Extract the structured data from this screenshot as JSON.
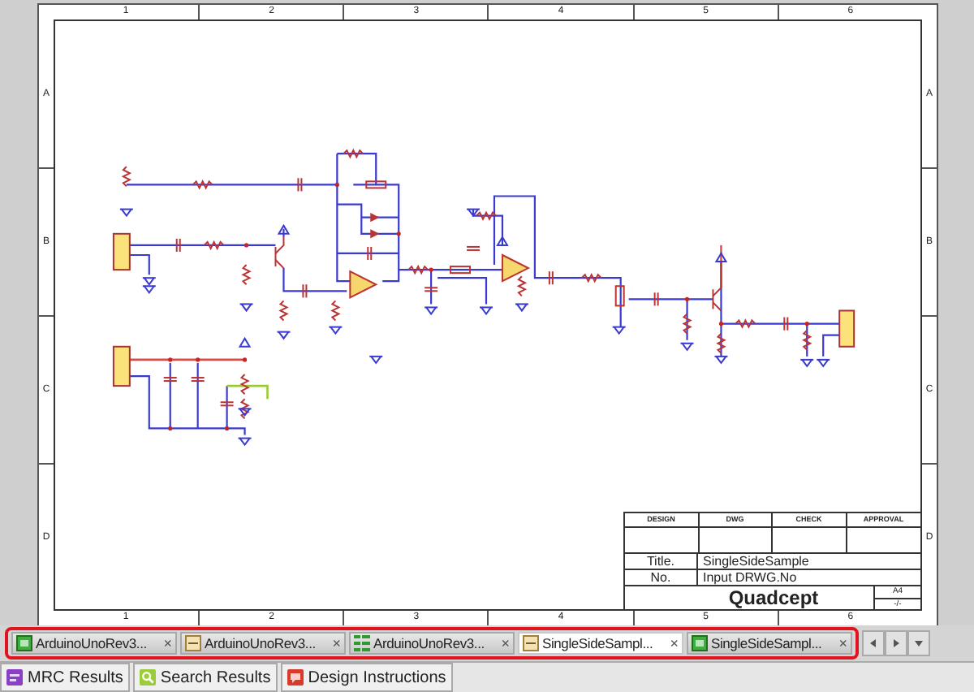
{
  "sheet": {
    "top_zones": [
      "1",
      "2",
      "3",
      "4",
      "5",
      "6"
    ],
    "side_zones_left": [
      "A",
      "B",
      "C",
      "D"
    ],
    "side_zones_right": [
      "A",
      "B",
      "C",
      "D"
    ],
    "bottom_zones": [
      "1",
      "2",
      "3",
      "4",
      "5",
      "6"
    ],
    "title_block": {
      "headers": [
        "DESIGN",
        "DWG",
        "CHECK",
        "APPROVAL"
      ],
      "title_label": "Title.",
      "title_value": "SingleSideSample",
      "number_label": "No.",
      "number_value": "Input DRWG.No",
      "company": "Quadcept",
      "size": "A4",
      "sheet_number": "-/-"
    }
  },
  "document_tabs": [
    {
      "label": "ArduinoUnoRev3...",
      "kind": "green",
      "close": "×",
      "selected": false
    },
    {
      "label": "ArduinoUnoRev3...",
      "kind": "tan",
      "close": "×",
      "selected": false
    },
    {
      "label": "ArduinoUnoRev3...",
      "kind": "grid",
      "close": "×",
      "selected": false
    },
    {
      "label": "SingleSideSampl...",
      "kind": "tan",
      "close": "×",
      "selected": true
    },
    {
      "label": "SingleSideSampl...",
      "kind": "green",
      "close": "×",
      "selected": false
    }
  ],
  "panel_tabs": [
    {
      "label": "MRC Results",
      "kind": "purple"
    },
    {
      "label": "Search Results",
      "kind": "search"
    },
    {
      "label": "Design Instructions",
      "kind": "red"
    }
  ]
}
